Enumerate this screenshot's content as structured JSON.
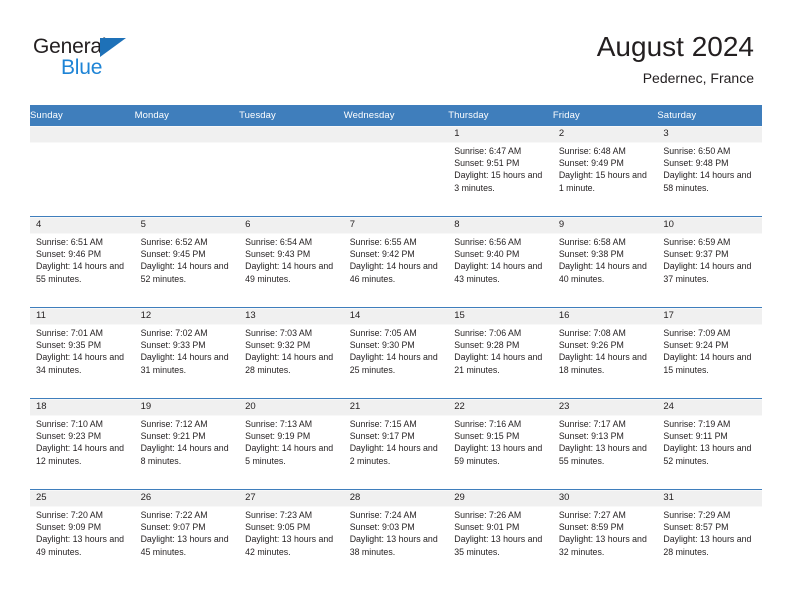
{
  "brand": {
    "name_part1": "General",
    "name_part2": "Blue",
    "accent_color": "#1e84d6",
    "triangle_color": "#1e71b8"
  },
  "header": {
    "title": "August 2024",
    "location": "Pedernec, France",
    "header_bg_color": "#3f7ebc"
  },
  "calendar": {
    "weekday_headers": [
      "Sunday",
      "Monday",
      "Tuesday",
      "Wednesday",
      "Thursday",
      "Friday",
      "Saturday"
    ],
    "labels": {
      "sunrise_prefix": "Sunrise:",
      "sunset_prefix": "Sunset:",
      "daylight_prefix": "Daylight:"
    },
    "weeks": [
      [
        {
          "day": "",
          "sunrise": "",
          "sunset": "",
          "daylight": ""
        },
        {
          "day": "",
          "sunrise": "",
          "sunset": "",
          "daylight": ""
        },
        {
          "day": "",
          "sunrise": "",
          "sunset": "",
          "daylight": ""
        },
        {
          "day": "",
          "sunrise": "",
          "sunset": "",
          "daylight": ""
        },
        {
          "day": "1",
          "sunrise": "Sunrise: 6:47 AM",
          "sunset": "Sunset: 9:51 PM",
          "daylight": "Daylight: 15 hours and 3 minutes."
        },
        {
          "day": "2",
          "sunrise": "Sunrise: 6:48 AM",
          "sunset": "Sunset: 9:49 PM",
          "daylight": "Daylight: 15 hours and 1 minute."
        },
        {
          "day": "3",
          "sunrise": "Sunrise: 6:50 AM",
          "sunset": "Sunset: 9:48 PM",
          "daylight": "Daylight: 14 hours and 58 minutes."
        }
      ],
      [
        {
          "day": "4",
          "sunrise": "Sunrise: 6:51 AM",
          "sunset": "Sunset: 9:46 PM",
          "daylight": "Daylight: 14 hours and 55 minutes."
        },
        {
          "day": "5",
          "sunrise": "Sunrise: 6:52 AM",
          "sunset": "Sunset: 9:45 PM",
          "daylight": "Daylight: 14 hours and 52 minutes."
        },
        {
          "day": "6",
          "sunrise": "Sunrise: 6:54 AM",
          "sunset": "Sunset: 9:43 PM",
          "daylight": "Daylight: 14 hours and 49 minutes."
        },
        {
          "day": "7",
          "sunrise": "Sunrise: 6:55 AM",
          "sunset": "Sunset: 9:42 PM",
          "daylight": "Daylight: 14 hours and 46 minutes."
        },
        {
          "day": "8",
          "sunrise": "Sunrise: 6:56 AM",
          "sunset": "Sunset: 9:40 PM",
          "daylight": "Daylight: 14 hours and 43 minutes."
        },
        {
          "day": "9",
          "sunrise": "Sunrise: 6:58 AM",
          "sunset": "Sunset: 9:38 PM",
          "daylight": "Daylight: 14 hours and 40 minutes."
        },
        {
          "day": "10",
          "sunrise": "Sunrise: 6:59 AM",
          "sunset": "Sunset: 9:37 PM",
          "daylight": "Daylight: 14 hours and 37 minutes."
        }
      ],
      [
        {
          "day": "11",
          "sunrise": "Sunrise: 7:01 AM",
          "sunset": "Sunset: 9:35 PM",
          "daylight": "Daylight: 14 hours and 34 minutes."
        },
        {
          "day": "12",
          "sunrise": "Sunrise: 7:02 AM",
          "sunset": "Sunset: 9:33 PM",
          "daylight": "Daylight: 14 hours and 31 minutes."
        },
        {
          "day": "13",
          "sunrise": "Sunrise: 7:03 AM",
          "sunset": "Sunset: 9:32 PM",
          "daylight": "Daylight: 14 hours and 28 minutes."
        },
        {
          "day": "14",
          "sunrise": "Sunrise: 7:05 AM",
          "sunset": "Sunset: 9:30 PM",
          "daylight": "Daylight: 14 hours and 25 minutes."
        },
        {
          "day": "15",
          "sunrise": "Sunrise: 7:06 AM",
          "sunset": "Sunset: 9:28 PM",
          "daylight": "Daylight: 14 hours and 21 minutes."
        },
        {
          "day": "16",
          "sunrise": "Sunrise: 7:08 AM",
          "sunset": "Sunset: 9:26 PM",
          "daylight": "Daylight: 14 hours and 18 minutes."
        },
        {
          "day": "17",
          "sunrise": "Sunrise: 7:09 AM",
          "sunset": "Sunset: 9:24 PM",
          "daylight": "Daylight: 14 hours and 15 minutes."
        }
      ],
      [
        {
          "day": "18",
          "sunrise": "Sunrise: 7:10 AM",
          "sunset": "Sunset: 9:23 PM",
          "daylight": "Daylight: 14 hours and 12 minutes."
        },
        {
          "day": "19",
          "sunrise": "Sunrise: 7:12 AM",
          "sunset": "Sunset: 9:21 PM",
          "daylight": "Daylight: 14 hours and 8 minutes."
        },
        {
          "day": "20",
          "sunrise": "Sunrise: 7:13 AM",
          "sunset": "Sunset: 9:19 PM",
          "daylight": "Daylight: 14 hours and 5 minutes."
        },
        {
          "day": "21",
          "sunrise": "Sunrise: 7:15 AM",
          "sunset": "Sunset: 9:17 PM",
          "daylight": "Daylight: 14 hours and 2 minutes."
        },
        {
          "day": "22",
          "sunrise": "Sunrise: 7:16 AM",
          "sunset": "Sunset: 9:15 PM",
          "daylight": "Daylight: 13 hours and 59 minutes."
        },
        {
          "day": "23",
          "sunrise": "Sunrise: 7:17 AM",
          "sunset": "Sunset: 9:13 PM",
          "daylight": "Daylight: 13 hours and 55 minutes."
        },
        {
          "day": "24",
          "sunrise": "Sunrise: 7:19 AM",
          "sunset": "Sunset: 9:11 PM",
          "daylight": "Daylight: 13 hours and 52 minutes."
        }
      ],
      [
        {
          "day": "25",
          "sunrise": "Sunrise: 7:20 AM",
          "sunset": "Sunset: 9:09 PM",
          "daylight": "Daylight: 13 hours and 49 minutes."
        },
        {
          "day": "26",
          "sunrise": "Sunrise: 7:22 AM",
          "sunset": "Sunset: 9:07 PM",
          "daylight": "Daylight: 13 hours and 45 minutes."
        },
        {
          "day": "27",
          "sunrise": "Sunrise: 7:23 AM",
          "sunset": "Sunset: 9:05 PM",
          "daylight": "Daylight: 13 hours and 42 minutes."
        },
        {
          "day": "28",
          "sunrise": "Sunrise: 7:24 AM",
          "sunset": "Sunset: 9:03 PM",
          "daylight": "Daylight: 13 hours and 38 minutes."
        },
        {
          "day": "29",
          "sunrise": "Sunrise: 7:26 AM",
          "sunset": "Sunset: 9:01 PM",
          "daylight": "Daylight: 13 hours and 35 minutes."
        },
        {
          "day": "30",
          "sunrise": "Sunrise: 7:27 AM",
          "sunset": "Sunset: 8:59 PM",
          "daylight": "Daylight: 13 hours and 32 minutes."
        },
        {
          "day": "31",
          "sunrise": "Sunrise: 7:29 AM",
          "sunset": "Sunset: 8:57 PM",
          "daylight": "Daylight: 13 hours and 28 minutes."
        }
      ]
    ]
  }
}
